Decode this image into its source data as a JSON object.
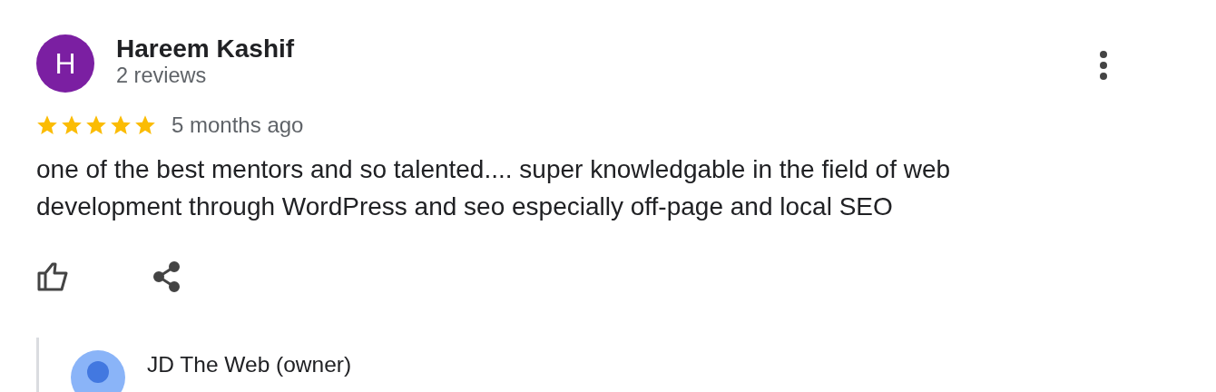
{
  "review": {
    "avatar_letter": "H",
    "author": "Hareem Kashif",
    "author_meta": "2 reviews",
    "stars": 5,
    "time": "5 months ago",
    "text": "one of the best mentors and so talented.... super knowledgable in the field of web development through WordPress and seo especially off-page and local SEO"
  },
  "reply": {
    "author": "JD The Web (owner)"
  }
}
